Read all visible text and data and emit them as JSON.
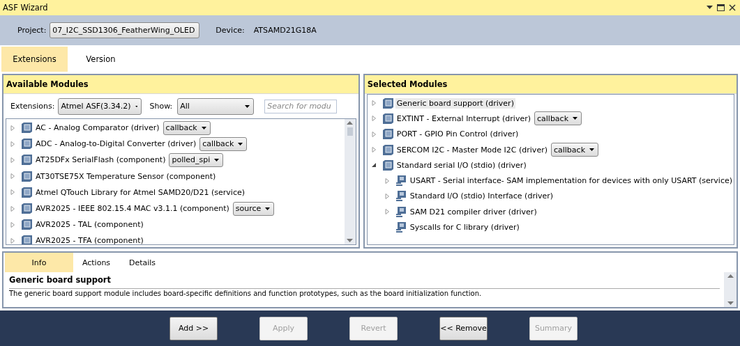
{
  "window": {
    "title": "ASF Wizard"
  },
  "project_bar": {
    "project_label": "Project:",
    "project_value": "07_I2C_SSD1306_FeatherWing_OLED",
    "device_label": "Device:",
    "device_value": "ATSAMD21G18A"
  },
  "tabs": [
    {
      "label": "Extensions",
      "selected": true
    },
    {
      "label": "Version",
      "selected": false
    }
  ],
  "available_modules": {
    "title": "Available Modules",
    "extensions_label": "Extensions:",
    "extensions_value": "Atmel ASF(3.34.2)",
    "show_label": "Show:",
    "show_value": "All",
    "search": {
      "placeholder": "Search for modu"
    },
    "items": [
      {
        "label": "AC - Analog Comparator (driver)",
        "option": "callback",
        "kind": "module",
        "expandable": true,
        "expanded": false,
        "selected": false
      },
      {
        "label": "ADC - Analog-to-Digital Converter (driver)",
        "option": "callback",
        "kind": "module",
        "expandable": true,
        "expanded": false,
        "selected": false
      },
      {
        "label": "AT25DFx SerialFlash (component)",
        "option": "polled_spi",
        "kind": "module",
        "expandable": true,
        "expanded": false,
        "selected": false
      },
      {
        "label": "AT30TSE75X Temperature Sensor (component)",
        "kind": "module",
        "expandable": true,
        "expanded": false,
        "selected": false
      },
      {
        "label": "Atmel QTouch Library for Atmel SAMD20/D21 (service)",
        "kind": "module",
        "expandable": true,
        "expanded": false,
        "selected": false
      },
      {
        "label": "AVR2025 - IEEE 802.15.4 MAC v3.1.1 (component)",
        "option": "source",
        "kind": "module",
        "expandable": true,
        "expanded": false,
        "selected": false
      },
      {
        "label": "AVR2025 - TAL (component)",
        "kind": "module",
        "expandable": true,
        "expanded": false,
        "selected": false
      },
      {
        "label": "AVR2025 - TFA (component)",
        "kind": "module",
        "expandable": true,
        "expanded": false,
        "selected": false
      }
    ]
  },
  "selected_modules": {
    "title": "Selected Modules",
    "items": [
      {
        "label": "Generic board support (driver)",
        "kind": "module",
        "expandable": true,
        "expanded": false,
        "selected": true
      },
      {
        "label": "EXTINT - External Interrupt (driver)",
        "option": "callback",
        "kind": "module",
        "expandable": true,
        "expanded": false,
        "selected": false
      },
      {
        "label": "PORT - GPIO Pin Control (driver)",
        "kind": "module",
        "expandable": true,
        "expanded": false,
        "selected": false
      },
      {
        "label": "SERCOM I2C - Master Mode I2C (driver)",
        "option": "callback",
        "kind": "module",
        "expandable": true,
        "expanded": false,
        "selected": false
      },
      {
        "label": "Standard serial I/O (stdio) (driver)",
        "kind": "module",
        "expandable": true,
        "expanded": true,
        "selected": false,
        "children": [
          {
            "label": "USART - Serial interface- SAM implementation for devices with only USART (service)",
            "kind": "dependency",
            "expandable": true,
            "selected": false
          },
          {
            "label": "Standard I/O (stdio) Interface (driver)",
            "kind": "dependency",
            "expandable": true,
            "selected": false
          },
          {
            "label": "SAM D21 compiler driver (driver)",
            "kind": "dependency",
            "expandable": true,
            "selected": false
          },
          {
            "label": "Syscalls for C library (driver)",
            "kind": "dependency",
            "expandable": false,
            "selected": false
          }
        ]
      }
    ]
  },
  "info_tabs": [
    {
      "label": "Info",
      "selected": true
    },
    {
      "label": "Actions",
      "selected": false
    },
    {
      "label": "Details",
      "selected": false
    }
  ],
  "info": {
    "heading": "Generic board support",
    "text": "The generic board support module includes board-specific definitions and function prototypes, such as the board initialization function."
  },
  "buttons": [
    {
      "label": "Add >>",
      "disabled": false
    },
    {
      "label": "Apply",
      "disabled": true
    },
    {
      "label": "Revert",
      "disabled": true
    },
    {
      "label": "<< Remove",
      "disabled": false
    },
    {
      "label": "Summary",
      "disabled": true
    }
  ]
}
